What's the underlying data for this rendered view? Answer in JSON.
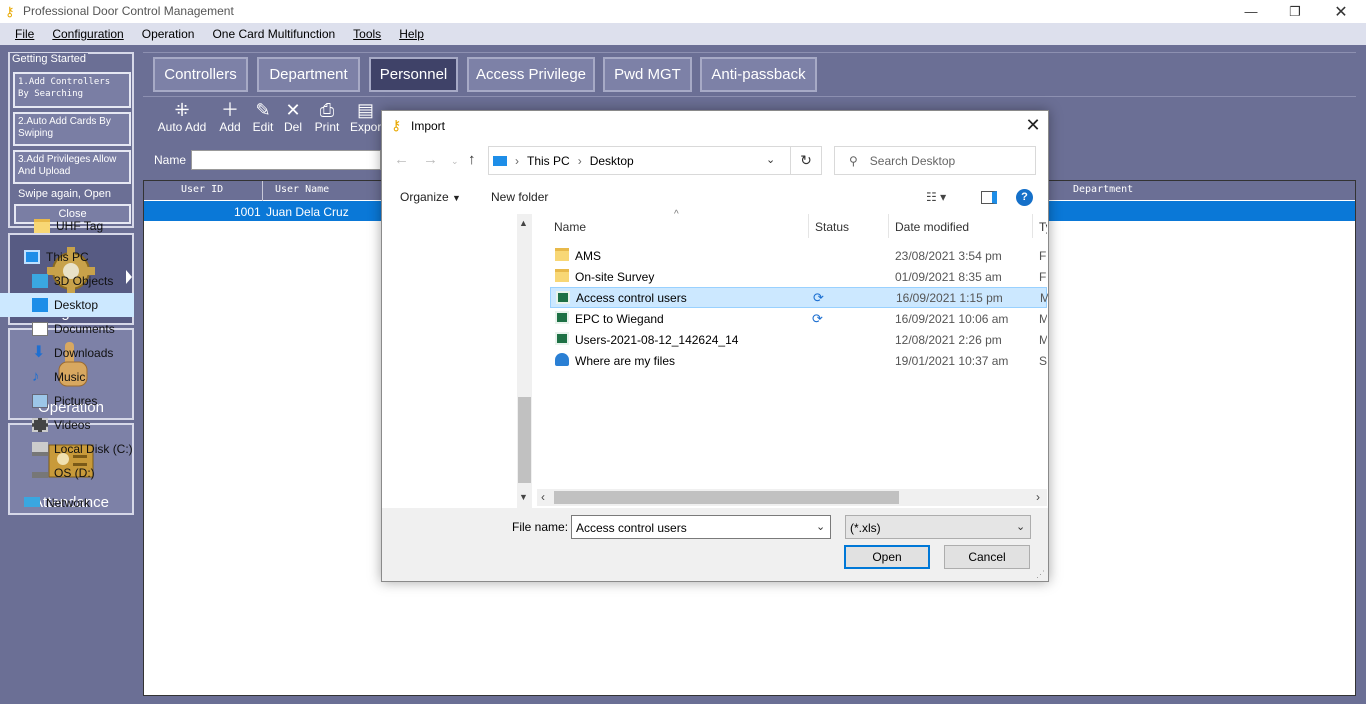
{
  "app": {
    "title": "Professional Door Control Management"
  },
  "menu": [
    "File",
    "Configuration",
    "Operation",
    "One Card Multifunction",
    "Tools",
    "Help"
  ],
  "getting_started": {
    "title": "Getting Started",
    "step1": "1.Add Controllers By Searching",
    "step2": "2.Auto Add Cards By Swiping",
    "step3": "3.Add Privileges Allow And Upload",
    "swipe": "Swipe again, Open",
    "close": "Close"
  },
  "nav": {
    "configuration": "Configuration",
    "operation": "Operation",
    "attendance": "Attendance"
  },
  "tabs": [
    "Controllers",
    "Department",
    "Personnel",
    "Access Privilege",
    "Pwd MGT",
    "Anti-passback"
  ],
  "toolbar": [
    "Auto Add",
    "Add",
    "Edit",
    "Del",
    "Print",
    "Expor"
  ],
  "filter": {
    "name_label": "Name"
  },
  "grid": {
    "headers": {
      "user_id": "User ID",
      "user_name": "User Name",
      "department": "Department"
    },
    "rows": [
      {
        "user_id": "1001",
        "user_name": "Juan  Dela Cruz"
      }
    ]
  },
  "dialog": {
    "title": "Import",
    "address": {
      "this_pc": "This PC",
      "desktop": "Desktop"
    },
    "search_placeholder": "Search Desktop",
    "organize": "Organize",
    "new_folder": "New folder",
    "tree": [
      "UHF Tag",
      "This PC",
      "3D Objects",
      "Desktop",
      "Documents",
      "Downloads",
      "Music",
      "Pictures",
      "Videos",
      "Local Disk (C:)",
      "OS (D:)",
      "Network"
    ],
    "columns": {
      "name": "Name",
      "status": "Status",
      "date": "Date modified",
      "type": "Ty"
    },
    "files": [
      {
        "name": "AMS",
        "date": "23/08/2021 3:54 pm",
        "type": "Fi"
      },
      {
        "name": "On-site Survey",
        "date": "01/09/2021 8:35 am",
        "type": "Fi"
      },
      {
        "name": "Access control users",
        "date": "16/09/2021 1:15 pm",
        "type": "M"
      },
      {
        "name": "EPC to Wiegand",
        "date": "16/09/2021 10:06 am",
        "type": "M"
      },
      {
        "name": "Users-2021-08-12_142624_14",
        "date": "12/08/2021 2:26 pm",
        "type": "M"
      },
      {
        "name": "Where are my files",
        "date": "19/01/2021 10:37 am",
        "type": "Sh"
      }
    ],
    "file_name_label": "File name:",
    "file_name_value": "Access control users",
    "file_type": "(*.xls)",
    "open": "Open",
    "cancel": "Cancel"
  }
}
